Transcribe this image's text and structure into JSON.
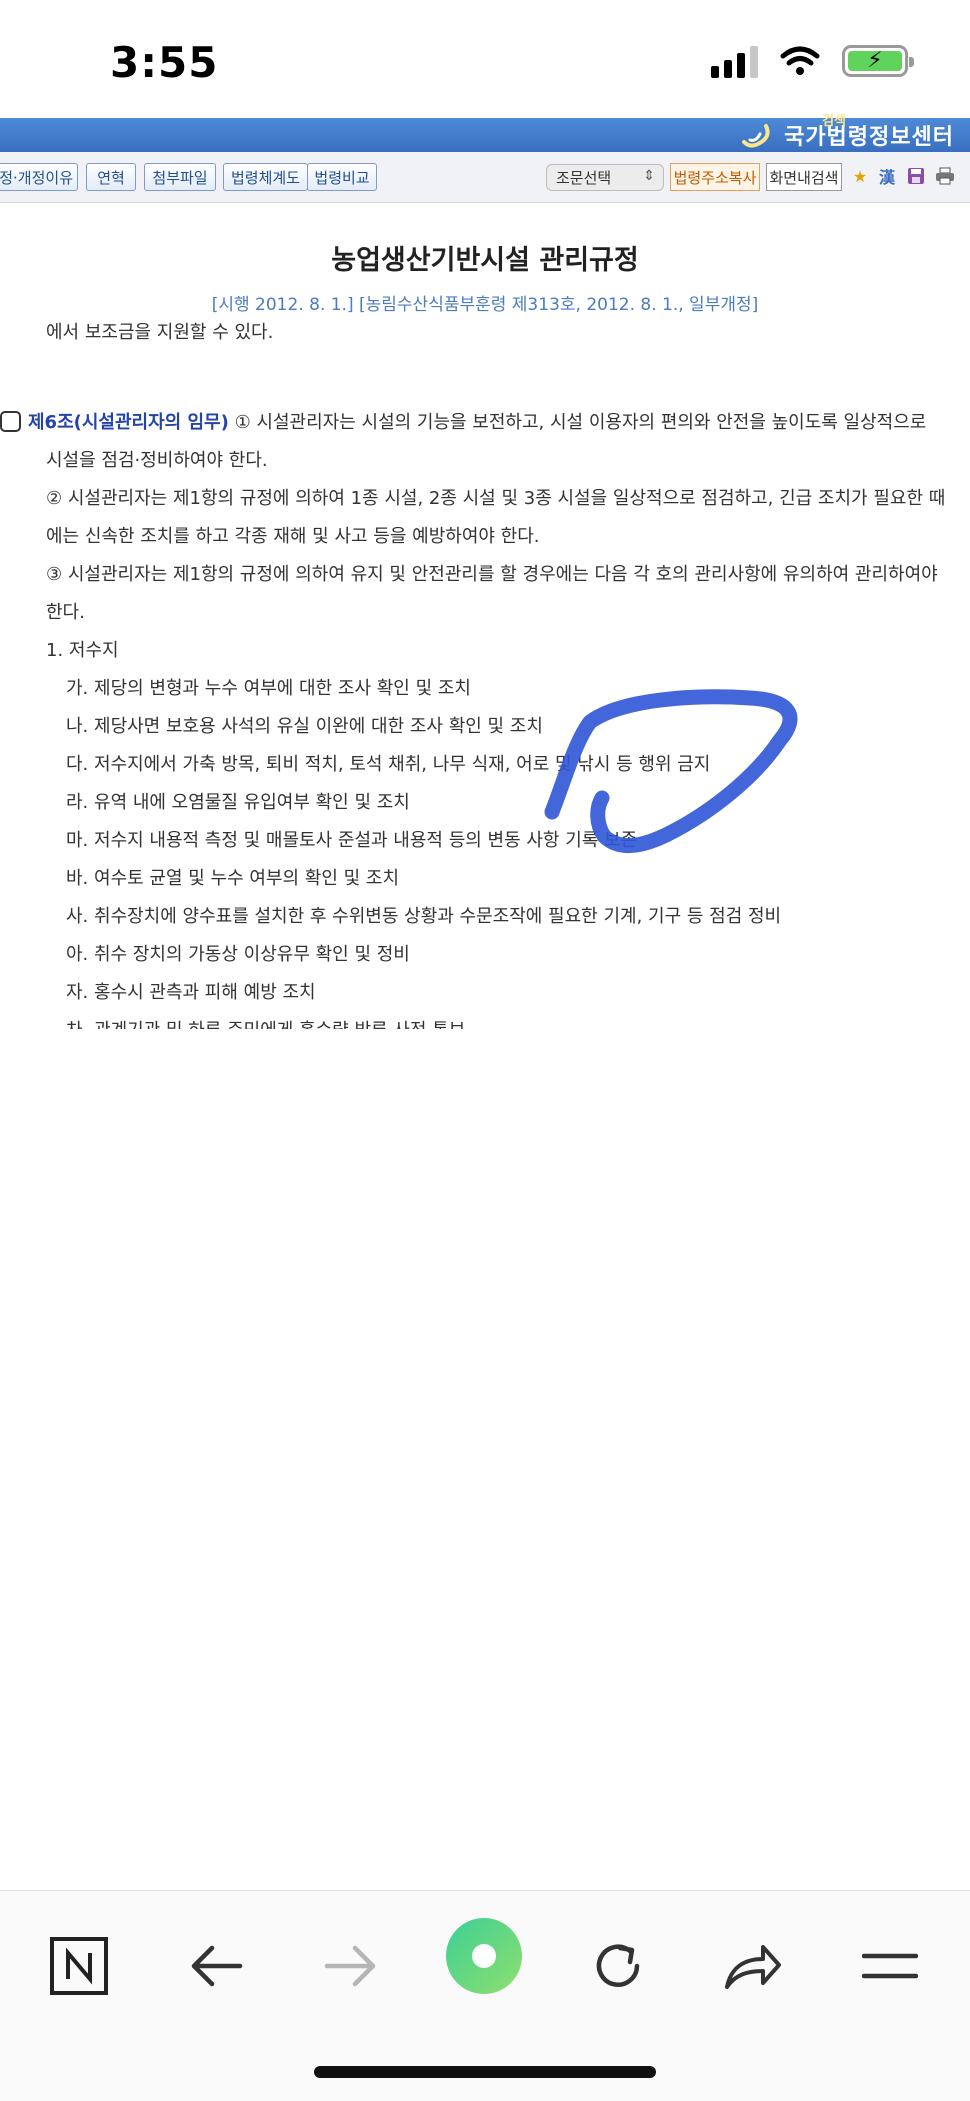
{
  "status_bar": {
    "time": "3:55",
    "icons": [
      "cellular-signal-icon",
      "wifi-icon",
      "battery-charging-icon"
    ]
  },
  "site": {
    "logo_small": "검색",
    "logo_text": "국가법령정보센터"
  },
  "toolbar": {
    "buttons": [
      "제정·개정이유",
      "연혁",
      "첨부파일",
      "법령체계도",
      "법령비교"
    ],
    "select_value": "조문선택",
    "copy_address": "법령주소복사",
    "in_screen_search": "화면내검색",
    "icons": [
      "star-icon",
      "hanja-icon",
      "save-icon",
      "print-icon"
    ]
  },
  "document": {
    "title": "농업생산기반시설 관리규정",
    "subtitle": "[시행 2012. 8. 1.] [농림수산식품부훈령 제313호, 2012. 8. 1., 일부개정]",
    "prev_line": "에서 보조금을 지원할 수 있다.",
    "article_head": "제6조(시설관리자의 임무)",
    "article_first": " ① 시설관리자는 시설의 기능을 보전하고, 시설 이용자의 편의와 안전을 높이도록 일상적으로",
    "lines": [
      "시설을 점검·정비하여야 한다.",
      "② 시설관리자는 제1항의 규정에 의하여 1종 시설, 2종 시설 및 3종 시설을 일상적으로 점검하고, 긴급 조치가 필요한 때",
      "에는 신속한 조치를 하고 각종 재해 및 사고 등을 예방하여야 한다.",
      "③ 시설관리자는 제1항의 규정에 의하여 유지 및 안전관리를 할 경우에는 다음 각 호의 관리사항에 유의하여 관리하여야",
      "한다.",
      "1. 저수지"
    ],
    "items": [
      "가. 제당의 변형과 누수 여부에 대한 조사 확인 및 조치",
      "나. 제당사면 보호용 사석의 유실 이완에 대한 조사 확인 및 조치",
      "다. 저수지에서 가축 방목, 퇴비 적치, 토석 채취, 나무 식재, 어로 및 낚시 등 행위 금지",
      "라. 유역 내에 오염물질 유입여부 확인 및 조치",
      "마. 저수지 내용적 측정 및 매몰토사 준설과 내용적 등의 변동 사항 기록 보존",
      "바. 여수토 균열 및 누수 여부의 확인 및 조치",
      "사. 취수장치에 양수표를 설치한 후 수위변동 상황과 수문조작에 필요한 기계, 기구 등 점검 정비",
      "아. 취수 장치의 가동상 이상유무 확인 및 정비",
      "자. 홍수시 관측과 피해 예방 조치",
      "차. 관계기관 및 하류 주민에게 홍수량 방류 사전 통보"
    ]
  },
  "bottom_nav": [
    "naver-home-icon",
    "back-arrow-icon",
    "forward-arrow-icon",
    "green-dot-icon",
    "reload-icon",
    "share-icon",
    "menu-icon"
  ],
  "colors": {
    "header_blue": "#3a6fc0",
    "article_blue": "#2444a8",
    "subtitle_blue": "#4a7cc0",
    "scribble_blue": "#2f56d6",
    "green_button": "#4fd08a"
  }
}
